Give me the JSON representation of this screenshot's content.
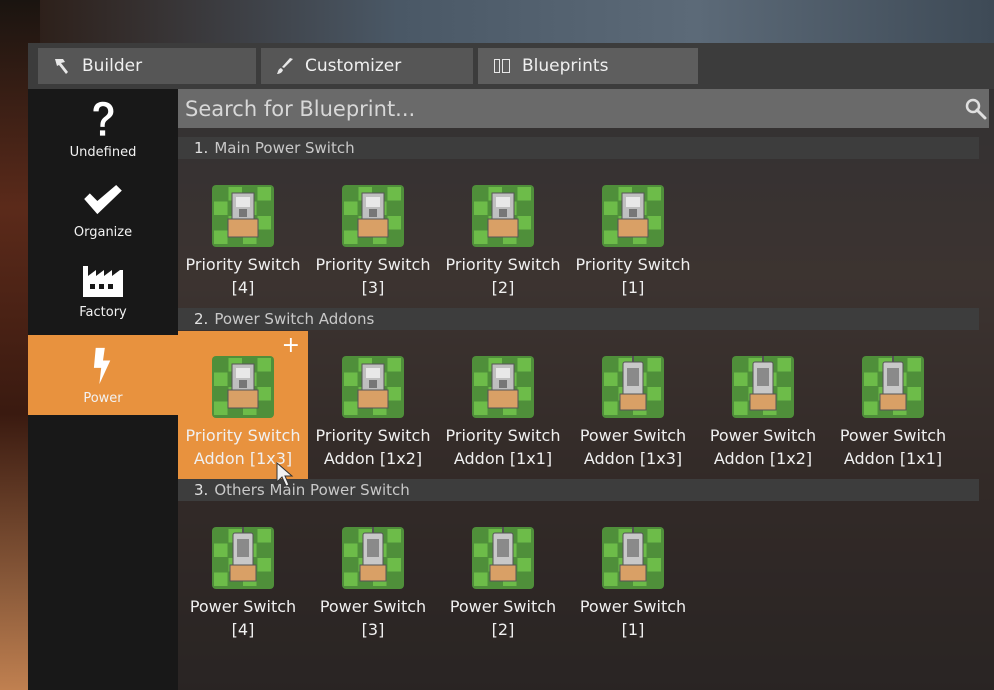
{
  "tabs": [
    {
      "label": "Builder",
      "icon": "hammer-icon"
    },
    {
      "label": "Customizer",
      "icon": "brush-icon"
    },
    {
      "label": "Blueprints",
      "icon": "blueprint-book-icon"
    }
  ],
  "active_tab": "Blueprints",
  "sidebar": {
    "items": [
      {
        "label": "Undefined",
        "icon": "question-mark-icon"
      },
      {
        "label": "Organize",
        "icon": "checkmark-icon"
      },
      {
        "label": "Factory",
        "icon": "factory-icon"
      },
      {
        "label": "Power",
        "icon": "power-bolt-icon"
      }
    ],
    "active": "Power"
  },
  "search": {
    "placeholder": "Search for Blueprint..."
  },
  "sections": [
    {
      "number": "1.",
      "title": "Main Power Switch",
      "items": [
        {
          "line1": "Priority Switch",
          "line2": "[4]",
          "kind": "priority"
        },
        {
          "line1": "Priority Switch",
          "line2": "[3]",
          "kind": "priority"
        },
        {
          "line1": "Priority Switch",
          "line2": "[2]",
          "kind": "priority"
        },
        {
          "line1": "Priority Switch",
          "line2": "[1]",
          "kind": "priority"
        }
      ]
    },
    {
      "number": "2.",
      "title": "Power Switch Addons",
      "items": [
        {
          "line1": "Priority Switch",
          "line2": "Addon [1x3]",
          "kind": "priority",
          "selected": true,
          "badge": "+"
        },
        {
          "line1": "Priority Switch",
          "line2": "Addon [1x2]",
          "kind": "priority"
        },
        {
          "line1": "Priority Switch",
          "line2": "Addon [1x1]",
          "kind": "priority"
        },
        {
          "line1": "Power Switch",
          "line2": "Addon [1x3]",
          "kind": "power"
        },
        {
          "line1": "Power Switch",
          "line2": "Addon [1x2]",
          "kind": "power"
        },
        {
          "line1": "Power Switch",
          "line2": "Addon [1x1]",
          "kind": "power"
        }
      ]
    },
    {
      "number": "3.",
      "title": "Others Main Power Switch",
      "items": [
        {
          "line1": "Power Switch",
          "line2": "[4]",
          "kind": "power"
        },
        {
          "line1": "Power Switch",
          "line2": "[3]",
          "kind": "power"
        },
        {
          "line1": "Power Switch",
          "line2": "[2]",
          "kind": "power"
        },
        {
          "line1": "Power Switch",
          "line2": "[1]",
          "kind": "power"
        }
      ]
    }
  ],
  "colors": {
    "accent": "#e8923e",
    "tile_green": "#6fbf4a",
    "tile_green_dark": "#4f8f3a"
  }
}
